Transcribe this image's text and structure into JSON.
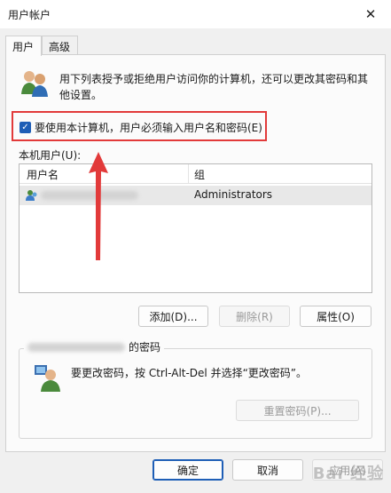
{
  "window": {
    "title": "用户帐户"
  },
  "tabs": [
    {
      "label": "用户"
    },
    {
      "label": "高级"
    }
  ],
  "info": {
    "text": "用下列表授予或拒绝用户访问你的计算机，还可以更改其密码和其他设置。"
  },
  "require_password": {
    "checked": true,
    "label": "要使用本计算机，用户必须输入用户名和密码(E)"
  },
  "users": {
    "label": "本机用户(U):",
    "columns": [
      "用户名",
      "组"
    ],
    "rows": [
      {
        "group": "Administrators"
      }
    ]
  },
  "user_buttons": {
    "add": "添加(D)...",
    "remove": "删除(R)",
    "properties": "属性(O)"
  },
  "password_group": {
    "title_suffix": "的密码",
    "instructions": "要更改密码，按 Ctrl-Alt-Del 并选择“更改密码”。",
    "reset_button": "重置密码(P)..."
  },
  "dialog_buttons": {
    "ok": "确定",
    "cancel": "取消",
    "apply": "应用(A)"
  },
  "watermark": "Bai 经验",
  "colors": {
    "accent": "#1e5eb6",
    "annotation": "#e23a3a",
    "watermark": "#969696"
  }
}
